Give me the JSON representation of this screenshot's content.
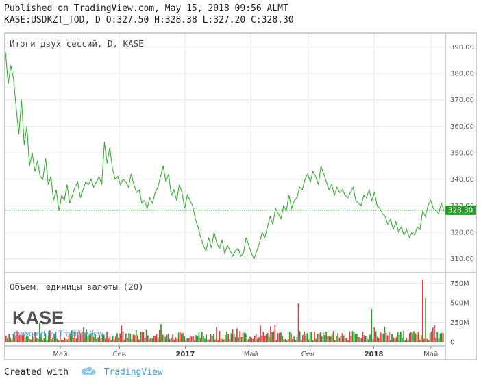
{
  "header": {
    "published": "Published on TradingView.com, May 15, 2018 09:56 ALMT",
    "symbol": "KASE:USDKZT_TOD",
    "ohlc_prefix": ", D",
    "open_label": "O:",
    "open": "327.50",
    "high_label": "H:",
    "high": "328.38",
    "low_label": "L:",
    "low": "327.20",
    "close_label": "C:",
    "close": "328.30"
  },
  "footer": {
    "created_with": "Created with",
    "brand": "TradingView"
  },
  "watermark": {
    "logo": "KASE",
    "powered": "powered by TradingView"
  },
  "colors": {
    "line": "#33b02f",
    "up": "#2d9b2d",
    "down": "#e23b3b",
    "grid": "#eaeaea",
    "label_bg": "#27a027"
  },
  "chart_data": [
    {
      "type": "line",
      "title": "Итоги двух сессий, D, KASE",
      "ylim": [
        305,
        395
      ],
      "yticks": [
        "390.00",
        "380.00",
        "370.00",
        "360.00",
        "350.00",
        "340.00",
        "330.00",
        "320.00",
        "310.00"
      ],
      "last_value_label": "328.30",
      "x_ticks": [
        "Май",
        "Сен",
        "2017",
        "Май",
        "Сен",
        "2018",
        "Май"
      ],
      "x_tick_pos": [
        0.125,
        0.26,
        0.41,
        0.56,
        0.69,
        0.84,
        0.97
      ],
      "bold_ticks": [
        "2017",
        "2018"
      ],
      "grid": true,
      "values": [
        388,
        376,
        383,
        378,
        367,
        357,
        370,
        353,
        360,
        345,
        350,
        343,
        347,
        341,
        340,
        348,
        338,
        341,
        332,
        336,
        328,
        334,
        332,
        338,
        331,
        334,
        337,
        339,
        333,
        336,
        339,
        338,
        340,
        337,
        339,
        341,
        338,
        354,
        346,
        352,
        344,
        340,
        341,
        338,
        340,
        339,
        337,
        342,
        338,
        335,
        336,
        331,
        332,
        329,
        333,
        331,
        335,
        337,
        341,
        345,
        339,
        342,
        334,
        336,
        332,
        338,
        335,
        329,
        334,
        332,
        330,
        325,
        322,
        318,
        315,
        313,
        318,
        314,
        320,
        316,
        314,
        317,
        312,
        315,
        313,
        311,
        313,
        314,
        311,
        312,
        318,
        315,
        312,
        310,
        313,
        316,
        320,
        318,
        322,
        326,
        323,
        329,
        327,
        325,
        330,
        328,
        334,
        329,
        332,
        333,
        337,
        336,
        340,
        342,
        339,
        343,
        341,
        338,
        345,
        342,
        339,
        336,
        338,
        334,
        337,
        335,
        336,
        334,
        333,
        335,
        337,
        332,
        331,
        330,
        334,
        333,
        336,
        332,
        335,
        330,
        329,
        327,
        326,
        323,
        325,
        321,
        324,
        320,
        322,
        319,
        321,
        318,
        320,
        319,
        322,
        321,
        328,
        326,
        330,
        332,
        329,
        328,
        327,
        331,
        328
      ]
    },
    {
      "type": "bar",
      "title": "Объем, единицы валюты (20)",
      "ylim": [
        0,
        850
      ],
      "yticks": [
        "750M",
        "500M",
        "250M",
        "0"
      ],
      "ytick_values": [
        750,
        500,
        250,
        0
      ],
      "note": "bar values in millions, up/down colored"
    }
  ]
}
